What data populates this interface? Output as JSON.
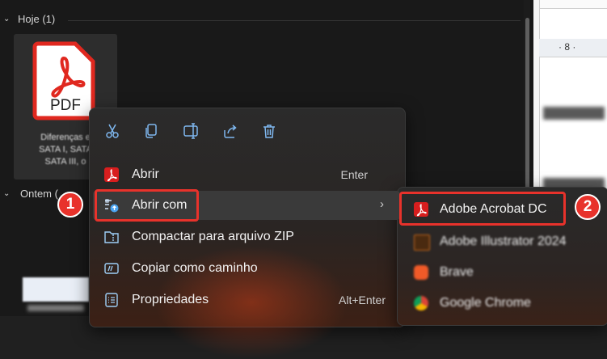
{
  "explorer": {
    "group_today": "Hoje (1)",
    "group_yesterday": "Ontem (",
    "file": {
      "icon_label": "PDF",
      "name_line1": "Diferenças e",
      "name_line2": "SATA I, SATA",
      "name_line3": "SATA III, o"
    }
  },
  "document": {
    "ruler_mark": "· 8 ·"
  },
  "context_menu": {
    "quick_actions": [
      "cut-icon",
      "copy-icon",
      "rename-icon",
      "share-icon",
      "delete-icon"
    ],
    "items": [
      {
        "label": "Abrir",
        "shortcut": "Enter",
        "icon": "acrobat-icon"
      },
      {
        "label": "Abrir com",
        "icon": "open-with-icon",
        "has_submenu": true
      },
      {
        "label": "Compactar para arquivo ZIP",
        "icon": "zip-folder-icon"
      },
      {
        "label": "Copiar como caminho",
        "icon": "copy-path-icon"
      },
      {
        "label": "Propriedades",
        "shortcut": "Alt+Enter",
        "icon": "properties-icon"
      }
    ]
  },
  "open_with_submenu": {
    "items": [
      {
        "label": "Adobe Acrobat DC",
        "icon": "acrobat-icon"
      },
      {
        "label": "Adobe Illustrator 2024",
        "icon": "illustrator-icon"
      },
      {
        "label": "Brave",
        "icon": "brave-icon"
      },
      {
        "label": "Google Chrome",
        "icon": "chrome-icon"
      }
    ]
  },
  "callouts": {
    "step1": "1",
    "step2": "2"
  },
  "colors": {
    "accent_red": "#e8322b",
    "acrobat_red": "#d81e1e",
    "menu_bg": "#2b2b2b"
  }
}
